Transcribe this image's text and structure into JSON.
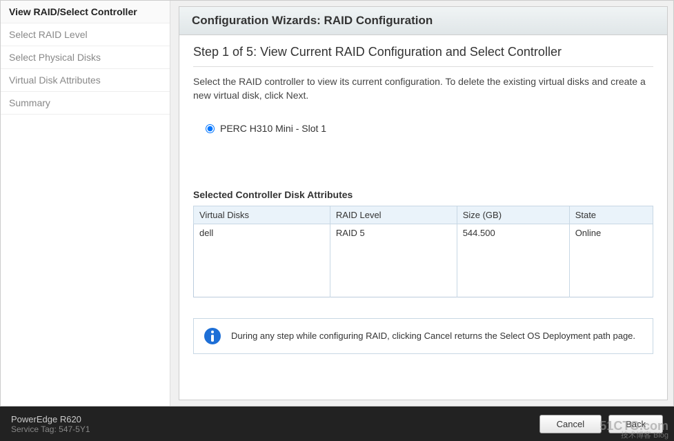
{
  "sidebar": {
    "items": [
      {
        "label": "View RAID/Select Controller",
        "active": true
      },
      {
        "label": "Select RAID Level",
        "active": false
      },
      {
        "label": "Select Physical Disks",
        "active": false
      },
      {
        "label": "Virtual Disk Attributes",
        "active": false
      },
      {
        "label": "Summary",
        "active": false
      }
    ]
  },
  "header": {
    "title": "Configuration Wizards: RAID Configuration"
  },
  "step": {
    "title": "Step 1 of 5: View Current RAID Configuration and Select Controller",
    "description": "Select the RAID controller to view its current configuration. To delete the existing virtual disks and create a new virtual disk, click Next."
  },
  "controller": {
    "option_label": "PERC H310 Mini - Slot 1",
    "selected": true
  },
  "attributes": {
    "section_title": "Selected Controller Disk Attributes",
    "columns": [
      "Virtual Disks",
      "RAID Level",
      "Size (GB)",
      "State"
    ],
    "rows": [
      {
        "virtual_disks": "dell",
        "raid_level": "RAID 5",
        "size_gb": "544.500",
        "state": "Online"
      }
    ]
  },
  "info": {
    "text": "During any step while configuring RAID, clicking Cancel returns the Select OS Deployment path page."
  },
  "footer": {
    "model": "PowerEdge R620",
    "service_tag_label": "Service Tag: 547-5Y1",
    "cancel": "Cancel",
    "back": "Back"
  },
  "watermark": {
    "main": "51CTO.com",
    "sub": "技术博客  Blog"
  }
}
